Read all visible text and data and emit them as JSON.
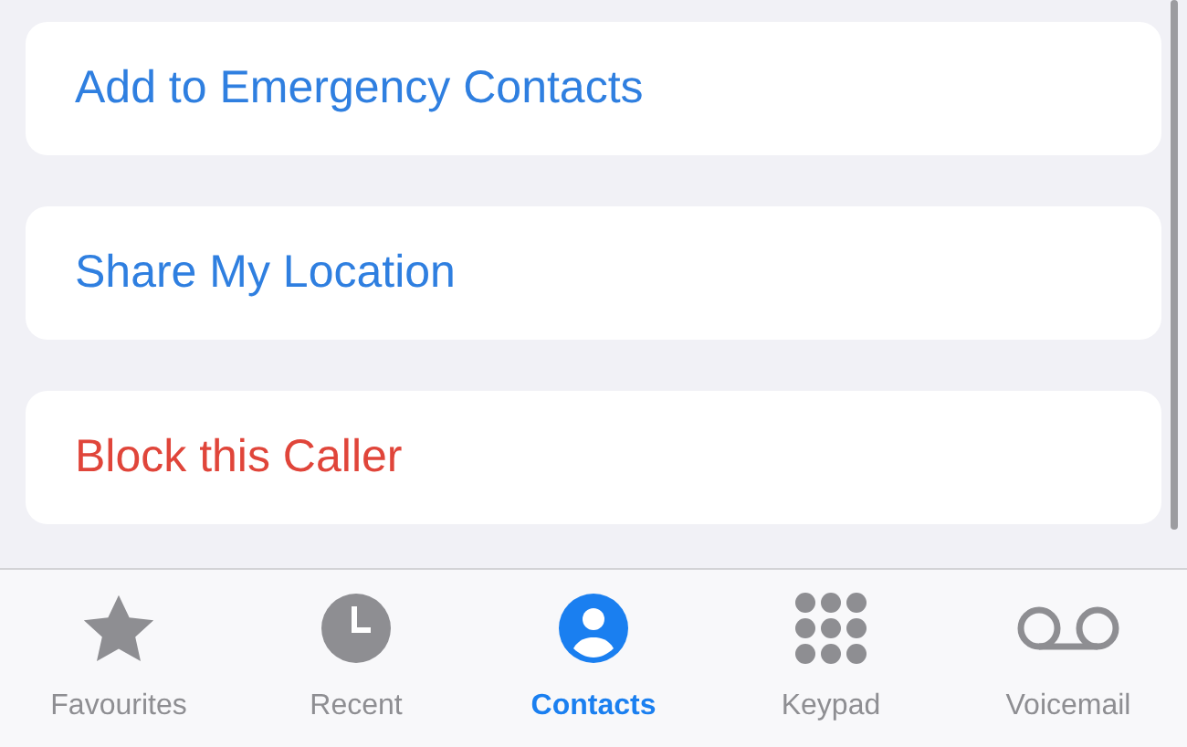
{
  "actions": [
    {
      "label": "Add to Emergency Contacts",
      "kind": "normal"
    },
    {
      "label": "Share My Location",
      "kind": "normal"
    },
    {
      "label": "Block this Caller",
      "kind": "destructive"
    }
  ],
  "tabs": [
    {
      "label": "Favourites",
      "kind": "star",
      "selected": false
    },
    {
      "label": "Recent",
      "kind": "clock",
      "selected": false
    },
    {
      "label": "Contacts",
      "kind": "person",
      "selected": true
    },
    {
      "label": "Keypad",
      "kind": "keypad",
      "selected": false
    },
    {
      "label": "Voicemail",
      "kind": "voicemail",
      "selected": false
    }
  ]
}
